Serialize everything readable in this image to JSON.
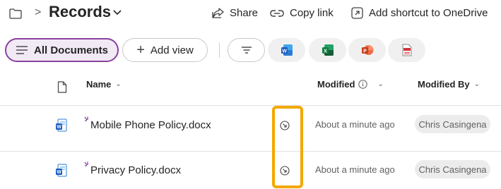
{
  "header": {
    "title": "Records",
    "commands": {
      "share": "Share",
      "copy_link": "Copy link",
      "add_shortcut": "Add shortcut to OneDrive"
    }
  },
  "toolbar": {
    "view_label": "All Documents",
    "add_view_label": "Add view",
    "app_filters": [
      "word-icon",
      "excel-icon",
      "powerpoint-icon",
      "pdf-icon"
    ]
  },
  "columns": {
    "name": "Name",
    "modified": "Modified",
    "modified_by": "Modified By"
  },
  "files": [
    {
      "name": "Mobile Phone Policy.docx",
      "modified": "About a minute ago",
      "modified_by": "Chris Casingena"
    },
    {
      "name": "Privacy Policy.docx",
      "modified": "About a minute ago",
      "modified_by": "Chris Casingena"
    }
  ],
  "colors": {
    "accent": "#8a3f9e",
    "highlight": "#f4a700",
    "word": "#185abd",
    "excel": "#107c41",
    "powerpoint": "#c43e1c",
    "pdf": "#d13438"
  }
}
